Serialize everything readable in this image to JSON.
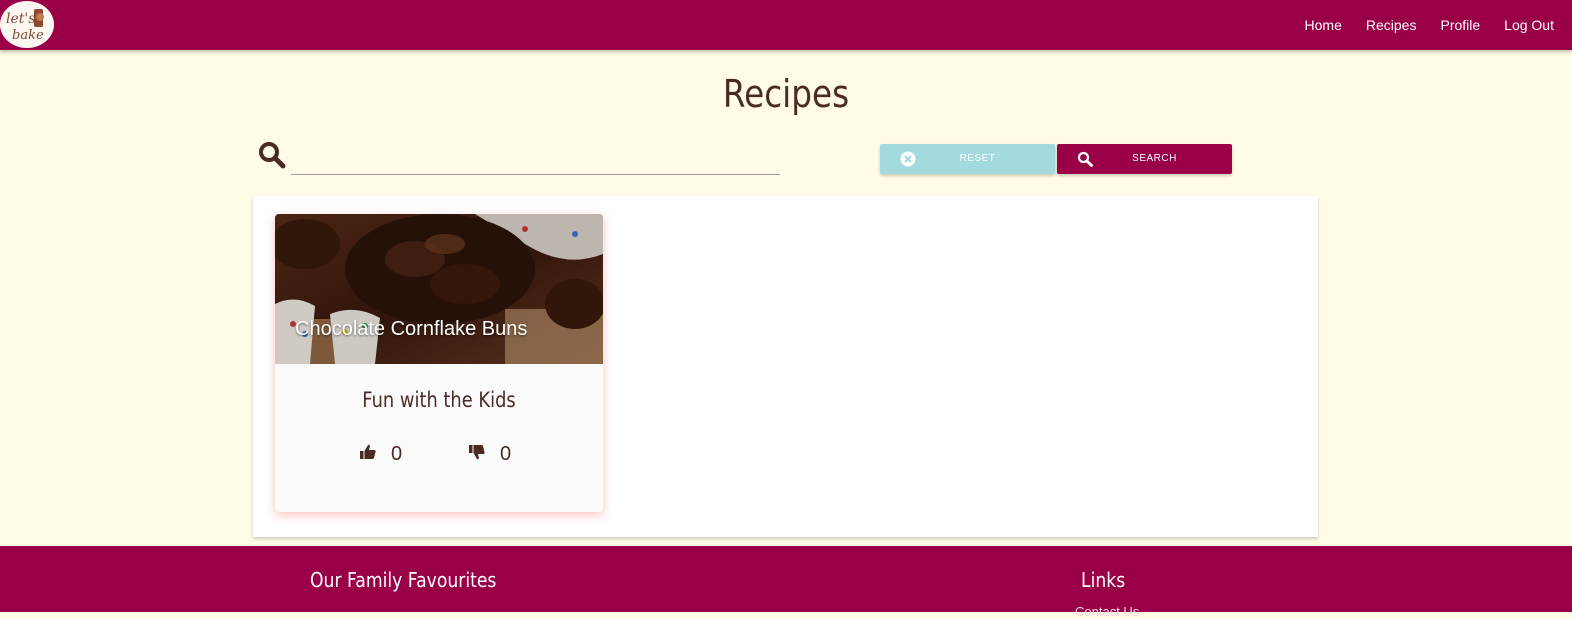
{
  "nav": {
    "logo_text": "let's bake",
    "links": [
      "Home",
      "Recipes",
      "Profile",
      "Log Out"
    ]
  },
  "page": {
    "title": "Recipes"
  },
  "search": {
    "value": "",
    "placeholder": "",
    "reset_label": "RESET",
    "search_label": "SEARCH"
  },
  "recipes": [
    {
      "title": "Chocolate Cornflake Buns",
      "category": "Fun with the Kids",
      "likes": "0",
      "dislikes": "0"
    }
  ],
  "footer": {
    "left_title": "Our Family Favourites",
    "right_title": "Links",
    "link_partial": "Contact Us"
  },
  "colors": {
    "brand": "#990048",
    "background": "#fffbe6",
    "reset": "#a3dadd",
    "text": "#4a2c25"
  },
  "icons": [
    "search-icon",
    "close-circle-icon",
    "thumbs-up-icon",
    "thumbs-down-icon"
  ]
}
